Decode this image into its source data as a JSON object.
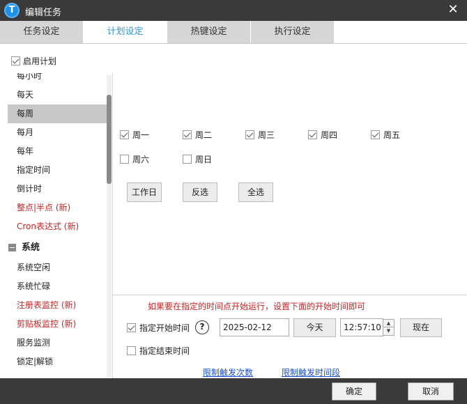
{
  "window": {
    "title": "编辑任务",
    "icon_letter": "T",
    "close_glyph": "✕"
  },
  "tabs": [
    {
      "label": "任务设定",
      "active": false
    },
    {
      "label": "计划设定",
      "active": true
    },
    {
      "label": "热键设定",
      "active": false
    },
    {
      "label": "执行设定",
      "active": false
    }
  ],
  "enable_plan": {
    "label": "启用计划",
    "checked": true
  },
  "sidebar": {
    "items": [
      {
        "label": "每小时",
        "selected": false,
        "is_new": false
      },
      {
        "label": "每天",
        "selected": false,
        "is_new": false
      },
      {
        "label": "每周",
        "selected": true,
        "is_new": false
      },
      {
        "label": "每月",
        "selected": false,
        "is_new": false
      },
      {
        "label": "每年",
        "selected": false,
        "is_new": false
      },
      {
        "label": "指定时间",
        "selected": false,
        "is_new": false
      },
      {
        "label": "倒计时",
        "selected": false,
        "is_new": false
      },
      {
        "label": "整点|半点 (新)",
        "selected": false,
        "is_new": true
      },
      {
        "label": "Cron表达式 (新)",
        "selected": false,
        "is_new": true
      }
    ],
    "group": {
      "label": "系统"
    },
    "group_items": [
      {
        "label": "系统空闲",
        "is_new": false
      },
      {
        "label": "系统忙碌",
        "is_new": false
      },
      {
        "label": "注册表监控 (新)",
        "is_new": true
      },
      {
        "label": "剪贴板监控 (新)",
        "is_new": true
      },
      {
        "label": "服务监测",
        "is_new": false
      },
      {
        "label": "锁定|解锁",
        "is_new": false
      }
    ]
  },
  "weekdays": [
    {
      "label": "周一",
      "checked": true
    },
    {
      "label": "周二",
      "checked": true
    },
    {
      "label": "周三",
      "checked": true
    },
    {
      "label": "周四",
      "checked": true
    },
    {
      "label": "周五",
      "checked": true
    },
    {
      "label": "周六",
      "checked": false
    },
    {
      "label": "周日",
      "checked": false
    }
  ],
  "day_buttons": {
    "workday": "工作日",
    "invert": "反选",
    "select_all": "全选"
  },
  "schedule": {
    "hint": "如果要在指定的时间点开始运行，设置下面的开始时间即可",
    "start_label": "指定开始时间",
    "start_checked": true,
    "help_glyph": "?",
    "start_date": "2025-02-12",
    "today_button": "今天",
    "start_time": "12:57:10",
    "now_button": "现在",
    "end_label": "指定结束时间",
    "end_checked": false,
    "limit_count_link": "限制触发次数",
    "limit_period_link": "限制触发时间段"
  },
  "footer": {
    "ok": "确定",
    "cancel": "取消"
  }
}
